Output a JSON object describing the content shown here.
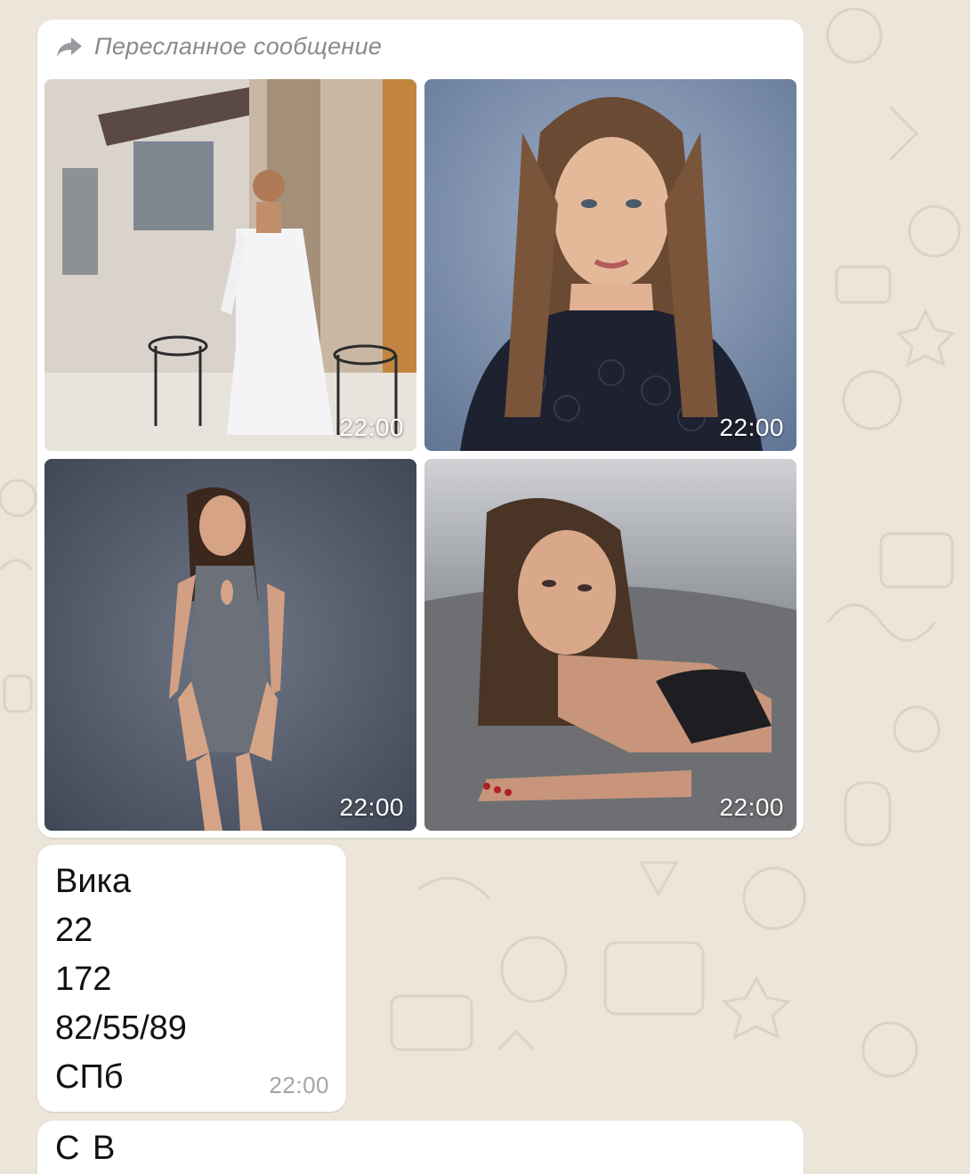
{
  "chat": {
    "forwarded_label": "Пересланное сообщение",
    "photos": [
      {
        "time": "22:00",
        "alt": "woman in white dress on street"
      },
      {
        "time": "22:00",
        "alt": "portrait in black lace top"
      },
      {
        "time": "22:00",
        "alt": "woman in grey bodysuit"
      },
      {
        "time": "22:00",
        "alt": "woman lying on grey sofa"
      }
    ],
    "profile_message": {
      "lines": [
        "Вика",
        "22",
        "172",
        "82/55/89",
        "СПб"
      ],
      "time": "22:00"
    },
    "next_message_partial": "С          В"
  },
  "colors": {
    "wallpaper": "#ece5da",
    "bubble": "#ffffff",
    "meta_text": "#8a8a8e"
  },
  "icons": {
    "forward": "forward-arrow-icon"
  }
}
